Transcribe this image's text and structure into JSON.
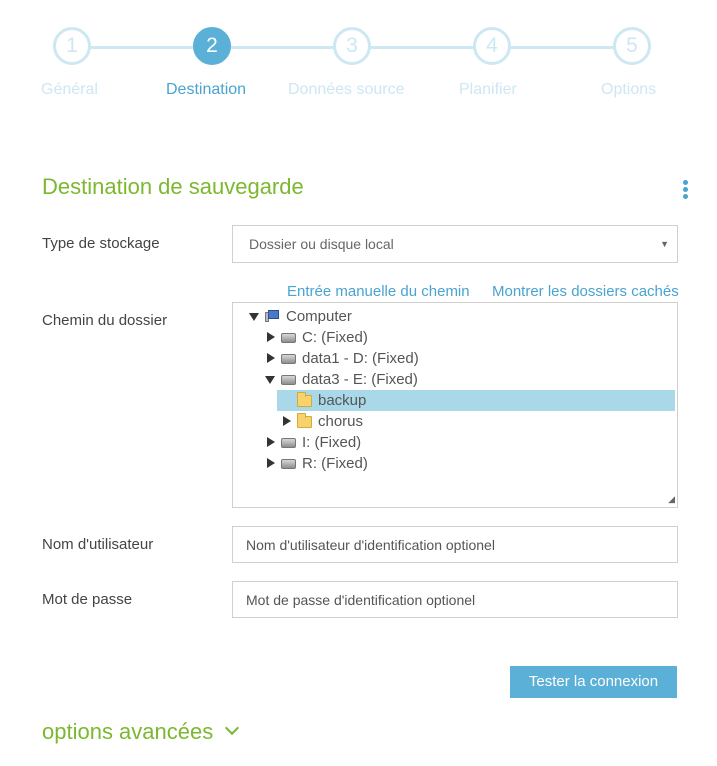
{
  "wizard": {
    "steps": [
      {
        "number": "1",
        "label": "Général",
        "state": "inactive"
      },
      {
        "number": "2",
        "label": "Destination",
        "state": "active"
      },
      {
        "number": "3",
        "label": "Données source",
        "state": "inactive"
      },
      {
        "number": "4",
        "label": "Planifier",
        "state": "inactive"
      },
      {
        "number": "5",
        "label": "Options",
        "state": "inactive"
      }
    ]
  },
  "section": {
    "title": "Destination de sauvegarde",
    "menu_icon": "kebab-menu-icon"
  },
  "storage": {
    "label": "Type de stockage",
    "selected": "Dossier ou disque local"
  },
  "path": {
    "label": "Chemin du dossier",
    "manual_link": "Entrée manuelle du chemin",
    "hidden_link": "Montrer les dossiers cachés",
    "tree": [
      {
        "text": "Computer",
        "icon": "computer-icon",
        "toggle": "expanded",
        "level": 0
      },
      {
        "text": "C: (Fixed)",
        "icon": "drive-icon",
        "toggle": "collapsed",
        "level": 1
      },
      {
        "text": "data1 - D: (Fixed)",
        "icon": "drive-icon",
        "toggle": "collapsed",
        "level": 1
      },
      {
        "text": "data3 - E: (Fixed)",
        "icon": "drive-icon",
        "toggle": "expanded",
        "level": 1
      },
      {
        "text": "backup",
        "icon": "folder-icon",
        "toggle": "none",
        "level": 2,
        "selected": true
      },
      {
        "text": "chorus",
        "icon": "folder-icon",
        "toggle": "collapsed",
        "level": 2
      },
      {
        "text": "I: (Fixed)",
        "icon": "drive-icon",
        "toggle": "collapsed",
        "level": 1
      },
      {
        "text": "R: (Fixed)",
        "icon": "drive-icon",
        "toggle": "collapsed",
        "level": 1
      }
    ]
  },
  "username": {
    "label": "Nom d'utilisateur",
    "placeholder": "Nom d'utilisateur d'identification optionel"
  },
  "password": {
    "label": "Mot de passe",
    "placeholder": "Mot de passe d'identification optionel"
  },
  "test_button": "Tester la connexion",
  "advanced_options": "options avancées",
  "colors": {
    "accent_blue": "#5bb0d8",
    "inactive_step": "#cde7f3",
    "green": "#7cb82f",
    "selection": "#a9d8e8"
  }
}
